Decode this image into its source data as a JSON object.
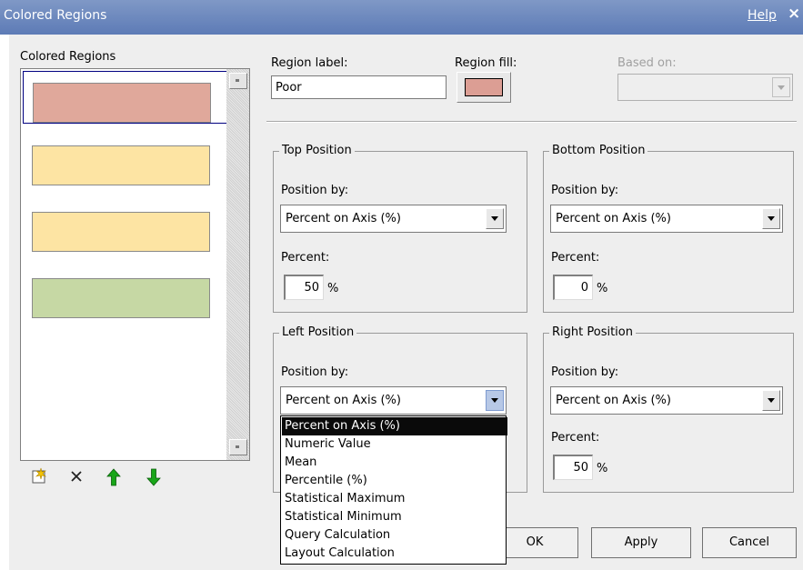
{
  "window": {
    "title": "Colored Regions",
    "help": "Help",
    "close_glyph": "×"
  },
  "regions_panel": {
    "label": "Colored Regions",
    "items": [
      {
        "color": "#e0a89b"
      },
      {
        "color": "#fde4a3"
      },
      {
        "color": "#fde4a3"
      },
      {
        "color": "#c6d8a4"
      }
    ],
    "selected_index": 0
  },
  "region": {
    "label_caption": "Region label:",
    "label_value": "Poor",
    "fill_caption": "Region fill:",
    "fill_color": "#dc9e94",
    "based_on_caption": "Based on:",
    "based_on_value": ""
  },
  "top": {
    "legend": "Top Position",
    "position_by_caption": "Position by:",
    "position_by": "Percent on Axis (%)",
    "percent_caption": "Percent:",
    "percent": "50",
    "unit": "%"
  },
  "bottom": {
    "legend": "Bottom Position",
    "position_by_caption": "Position by:",
    "position_by": "Percent on Axis (%)",
    "percent_caption": "Percent:",
    "percent": "0",
    "unit": "%"
  },
  "left": {
    "legend": "Left Position",
    "position_by_caption": "Position by:",
    "position_by": "Percent on Axis (%)"
  },
  "right": {
    "legend": "Right Position",
    "position_by_caption": "Position by:",
    "position_by": "Percent on Axis (%)",
    "percent_caption": "Percent:",
    "percent": "50",
    "unit": "%"
  },
  "dropdown": {
    "options": [
      "Percent on Axis (%)",
      "Numeric Value",
      "Mean",
      "Percentile (%)",
      "Statistical Maximum",
      "Statistical Minimum",
      "Query Calculation",
      "Layout Calculation"
    ],
    "selected_index": 0
  },
  "buttons": {
    "ok": "OK",
    "apply": "Apply",
    "cancel": "Cancel"
  },
  "toolbar_icons": [
    "new-region-icon",
    "delete-icon",
    "move-up-icon",
    "move-down-icon"
  ]
}
